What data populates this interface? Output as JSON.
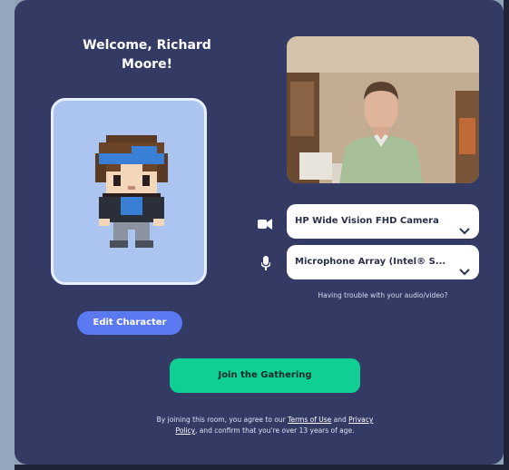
{
  "welcome": {
    "line1": "Welcome, Richard",
    "line2": "Moore!"
  },
  "avatar": {
    "edit_label": "Edit Character"
  },
  "devices": {
    "camera_label": "HP Wide Vision FHD Camera",
    "microphone_label": "Microphone Array (Intel® S..."
  },
  "trouble_text": "Having trouble with your audio/video?",
  "join_label": "Join the Gathering",
  "terms": {
    "part1": "By joining this room, you agree to our ",
    "terms_link": "Terms of Use",
    "part2": " and ",
    "privacy_link_a": "Privacy",
    "privacy_link_b": "Policy",
    "part3": ", and confirm that you're over 13 years of age."
  },
  "icons": {
    "camera": "video-camera-icon",
    "microphone": "microphone-icon",
    "chevron": "chevron-down-icon"
  },
  "colors": {
    "modal_bg": "#333a64",
    "avatar_card": "#abc4f0",
    "edit_button": "#5b79f0",
    "join_button": "#0fcf95"
  }
}
